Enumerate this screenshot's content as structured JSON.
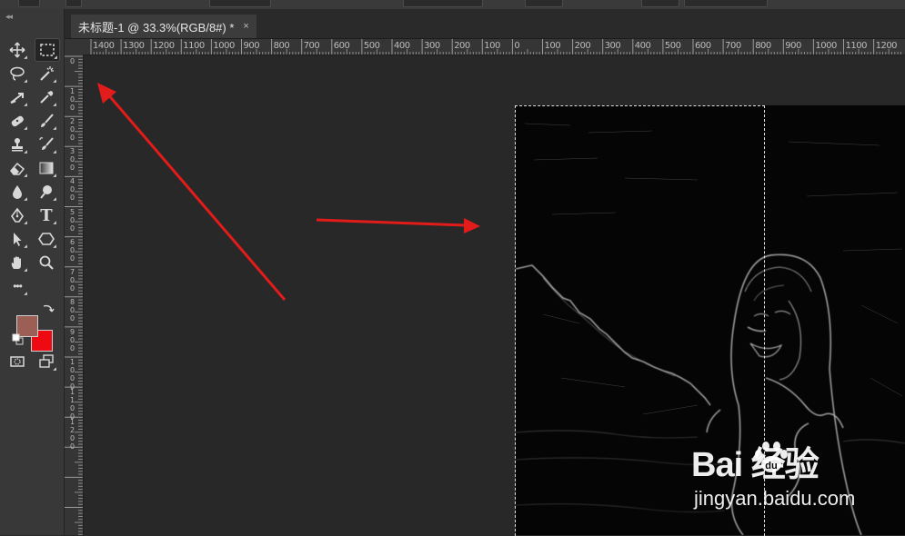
{
  "document_tab": {
    "title": "未标题-1 @ 33.3%(RGB/8#) *",
    "close_glyph": "×"
  },
  "ruler": {
    "horizontal_ticks": [
      "1400",
      "1300",
      "1200",
      "1100",
      "1000",
      "900",
      "800",
      "700",
      "600",
      "500",
      "400",
      "300",
      "200",
      "100",
      "0",
      "100",
      "200",
      "300",
      "400",
      "500",
      "600",
      "700",
      "800",
      "900",
      "1000",
      "1100",
      "1200"
    ],
    "vertical_ticks": [
      "0",
      "1 0 0",
      "2 0 0",
      "3 0 0",
      "4 0 0",
      "5 0 0",
      "6 0 0",
      "7 0 0",
      "8 0 0",
      "9 0 0",
      "1 0 0 0",
      "1 1 0 0",
      "1 2 0 0"
    ]
  },
  "toolbar": {
    "collapse_glyph": "◂◂",
    "more_glyph": "•••",
    "tools": [
      "move-tool",
      "marquee-tool",
      "lasso-tool",
      "magic-wand-tool",
      "crop-tool",
      "eyedropper-tool",
      "healing-brush-tool",
      "brush-tool",
      "clone-stamp-tool",
      "history-brush-tool",
      "eraser-tool",
      "gradient-tool",
      "blur-tool",
      "dodge-tool",
      "pen-tool",
      "text-tool",
      "path-selection-tool",
      "shape-tool",
      "hand-tool",
      "zoom-tool"
    ],
    "text_tool_glyph": "T"
  },
  "colors": {
    "foreground": "#9b5f55",
    "background": "#ee0a12",
    "arrow": "#e21b1b",
    "selection": "#e0e0e0"
  },
  "watermark": {
    "main": "Bai 经验",
    "sub": "jingyan.baidu.com"
  }
}
